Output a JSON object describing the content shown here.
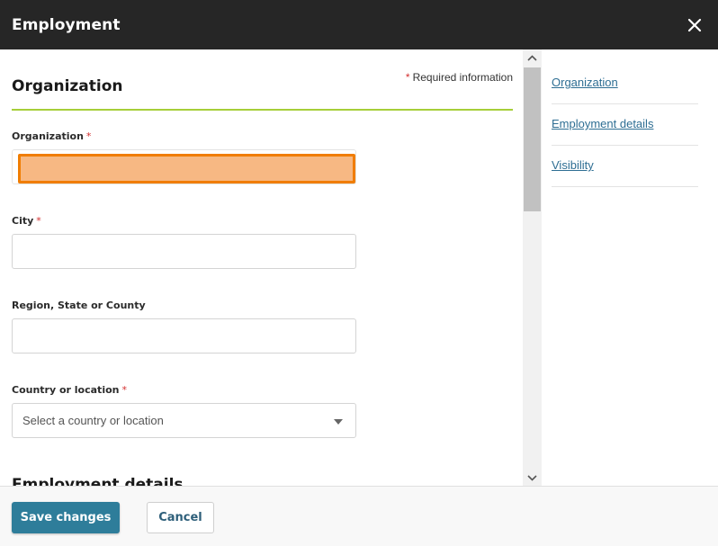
{
  "dialog": {
    "title": "Employment",
    "close_icon": "close-icon"
  },
  "form": {
    "section_title": "Organization",
    "required_note": {
      "star": "*",
      "text": "Required information"
    },
    "fields": {
      "organization": {
        "label": "Organization",
        "star": "*",
        "value": ""
      },
      "city": {
        "label": "City",
        "star": "*",
        "value": ""
      },
      "region": {
        "label": "Region, State or County",
        "value": ""
      },
      "country": {
        "label": "Country or location",
        "star": "*",
        "placeholder": "Select a country or location"
      }
    },
    "next_section_title": "Employment details"
  },
  "side_nav": {
    "items": [
      {
        "label": "Organization"
      },
      {
        "label": "Employment details"
      },
      {
        "label": "Visibility"
      }
    ]
  },
  "footer": {
    "save_label": "Save changes",
    "cancel_label": "Cancel"
  },
  "colors": {
    "header_bg": "#262626",
    "accent_rule": "#a6ce39",
    "focus_border": "#f07d00",
    "focus_fill": "#f7b883",
    "primary_button": "#2e7d9a",
    "link": "#2e6e93",
    "required_star": "#d32f2f"
  }
}
